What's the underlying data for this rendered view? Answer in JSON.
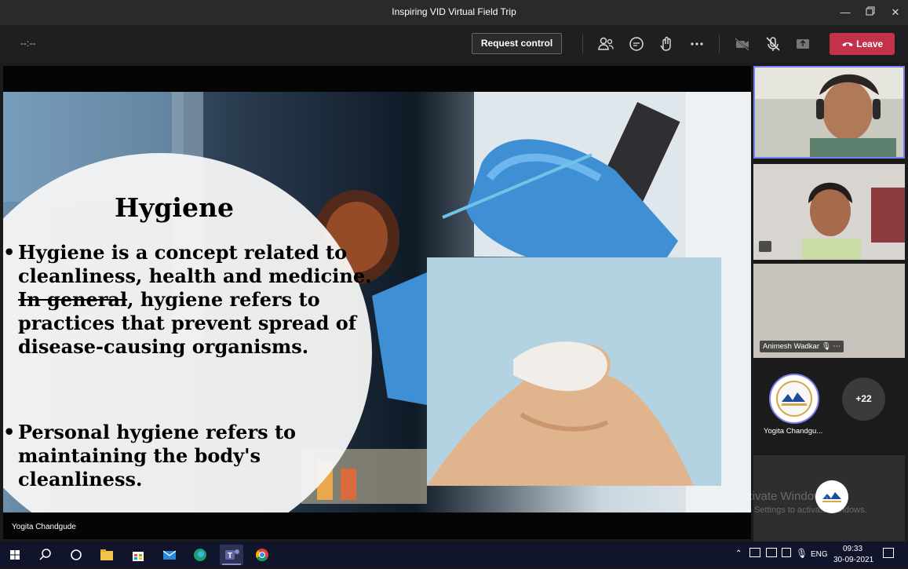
{
  "window": {
    "title": "Inspiring VID Virtual Field Trip"
  },
  "toolbar": {
    "timer": "--:--",
    "request_control": "Request control",
    "leave": "Leave"
  },
  "slide": {
    "title": "Hygiene",
    "bullet1": {
      "before": "Hygiene is a concept related to cleanliness, health and medicine.  ",
      "struck": "In general",
      "after": ", hygiene refers to practices that prevent spread of disease-causing organisms."
    },
    "bullet2": "Personal hygiene refers to maintaining the body's cleanliness."
  },
  "presenter": {
    "name": "Yogita Chandgude"
  },
  "participants": {
    "tile3_name": "Animesh Wadkar",
    "avatar_name": "Yogita Chandgu...",
    "overflow_count": "+22"
  },
  "watermark": {
    "line1": "Activate Windows",
    "line2": "Go to Settings to activate Windows."
  },
  "taskbar": {
    "lang": "ENG",
    "time": "09:33",
    "date": "30-09-2021"
  },
  "colors": {
    "leave": "#c4314b",
    "accent": "#7b7ff0",
    "taskbar": "#10152b"
  }
}
